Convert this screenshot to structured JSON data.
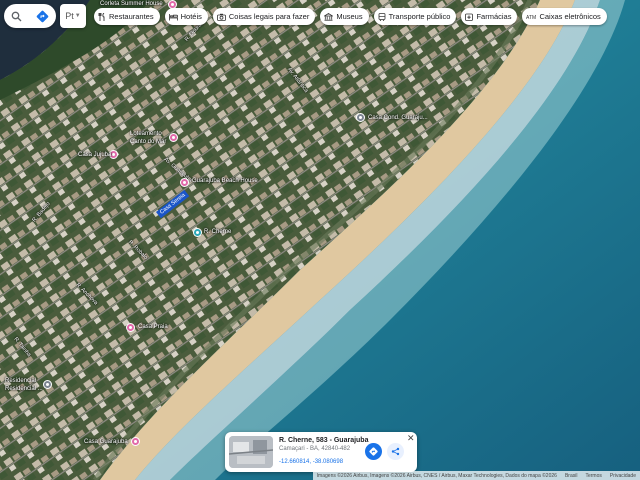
{
  "search": {
    "language_label": "Pt"
  },
  "chips": [
    {
      "icon": "fork-knife-icon",
      "label": "Restaurantes"
    },
    {
      "icon": "bed-icon",
      "label": "Hotéis"
    },
    {
      "icon": "camera-icon",
      "label": "Coisas legais para fazer"
    },
    {
      "icon": "museum-icon",
      "label": "Museus"
    },
    {
      "icon": "bus-icon",
      "label": "Transporte público"
    },
    {
      "icon": "pharmacy-icon",
      "label": "Farmácias"
    },
    {
      "icon": "atm-icon",
      "label": "Caixas eletrônicos"
    }
  ],
  "places": {
    "corleta": "Corleta Summer House",
    "casa_guaju": "Casa Jujuba",
    "loteamento_line1": "Loteamento",
    "loteamento_line2": "Canto do Mar",
    "guarajuba_beach": "Guarajuba Beach House",
    "caseta": "Casa Cond. Guaraju...",
    "r_cherne": "R. Cherne",
    "casa_praia": "Casa Praia",
    "casa_line2": "Residencial ...",
    "casa_guarajuba": "Casa Guarajuba",
    "residencial": "Residencial"
  },
  "roads": {
    "r_dourado": "R. Dourado",
    "av_atlantica": "Av. Atlântica",
    "r_badejo": "R. Badejo",
    "r_robalo": "R. Robalo",
    "r_anchova": "R. Anchova",
    "r_tainha": "R. Tainha",
    "av_guarajuba": "Av. Guarajuba"
  },
  "selected_street_tag": "Casa Sereia",
  "place_card": {
    "title": "R. Cherne, 583 - Guarajuba",
    "subtitle": "Camaçari - BA, 42840-482",
    "coords": "-12.660814, -38.080698"
  },
  "footer": {
    "attribution": "Imagens ©2026 Airbus, Imagens ©2026 Airbus, CNES / Airbus, Maxar Technologies, Dados do mapa ©2026",
    "country": "Brasil",
    "terms": "Termos",
    "privacy": "Privacidade"
  }
}
